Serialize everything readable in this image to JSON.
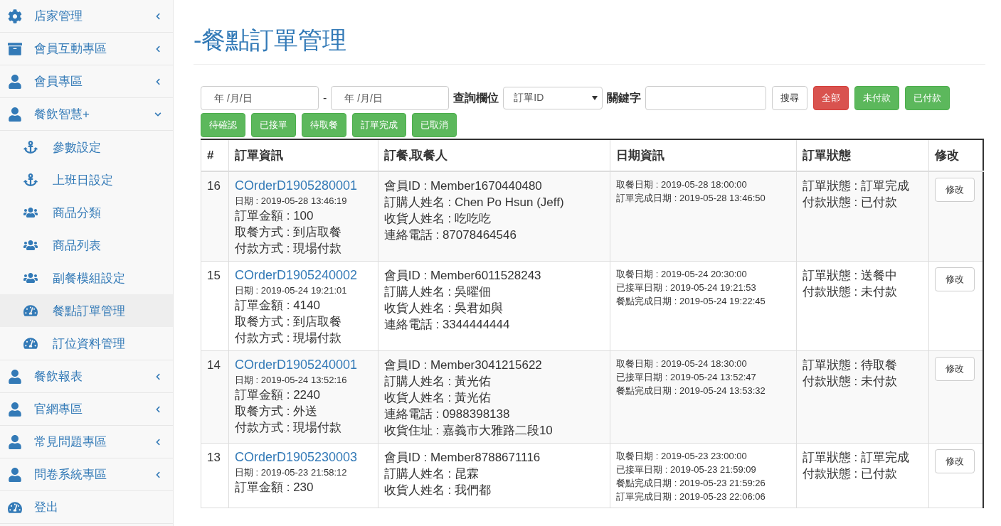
{
  "sidebar": {
    "items": [
      {
        "label": "店家管理",
        "kind": "settings",
        "expanded": false
      },
      {
        "label": "會員互動專區",
        "kind": "archive",
        "expanded": false
      },
      {
        "label": "會員專區",
        "kind": "user",
        "expanded": false
      },
      {
        "label": "餐飲智慧+",
        "kind": "user",
        "expanded": true,
        "children": [
          {
            "label": "參數設定",
            "kind": "anchor",
            "selected": false
          },
          {
            "label": "上班日設定",
            "kind": "anchor",
            "selected": false
          },
          {
            "label": "商品分類",
            "kind": "group",
            "selected": false
          },
          {
            "label": "商品列表",
            "kind": "group",
            "selected": false
          },
          {
            "label": "副餐模組設定",
            "kind": "group",
            "selected": false
          },
          {
            "label": "餐點訂單管理",
            "kind": "gauge",
            "selected": true
          },
          {
            "label": "訂位資料管理",
            "kind": "gauge",
            "selected": false
          }
        ]
      },
      {
        "label": "餐飲報表",
        "kind": "user",
        "expanded": false
      },
      {
        "label": "官網專區",
        "kind": "user",
        "expanded": false
      },
      {
        "label": "常見問題專區",
        "kind": "user",
        "expanded": false
      },
      {
        "label": "問卷系統專區",
        "kind": "user",
        "expanded": false
      }
    ],
    "logout": {
      "label": "登出"
    }
  },
  "page_title": "-餐點訂單管理",
  "filters": {
    "date_from": {
      "placeholder": "年 /月/日"
    },
    "separator": "-",
    "date_to": {
      "placeholder": "年 /月/日"
    },
    "field_label": "查詢欄位",
    "field_select": {
      "value": "訂單ID"
    },
    "keyword_label": "關鍵字",
    "search_button": "搜尋",
    "status_buttons": [
      {
        "label": "全部",
        "kind": "danger"
      },
      {
        "label": "未付款",
        "kind": "success"
      },
      {
        "label": "已付款",
        "kind": "success"
      },
      {
        "label": "待確認",
        "kind": "success"
      },
      {
        "label": "已接單",
        "kind": "success"
      },
      {
        "label": "待取餐",
        "kind": "success"
      },
      {
        "label": "訂單完成",
        "kind": "success"
      },
      {
        "label": "已取消",
        "kind": "success"
      }
    ]
  },
  "table": {
    "columns": [
      "#",
      "訂單資訊",
      "訂餐,取餐人",
      "日期資訊",
      "訂單狀態",
      "修改"
    ],
    "rows": [
      {
        "no": "16",
        "order_id": "COrderD1905280001",
        "date": "日期 : 2019-05-28 13:46:19",
        "order_lines": [
          "訂單金額 : 100",
          "取餐方式 : 到店取餐",
          "付款方式 : 現場付款"
        ],
        "customer": [
          "會員ID : Member1670440480",
          "訂購人姓名 : Chen Po Hsun (Jeff)",
          "收貨人姓名 : 吃吃吃",
          "連絡電話 : 87078464546"
        ],
        "dates": [
          "取餐日期 : 2019-05-28 18:00:00",
          "訂單完成日期 : 2019-05-28 13:46:50"
        ],
        "status": [
          "訂單狀態 : 訂單完成",
          "付款狀態 : 已付款"
        ],
        "action": "修改"
      },
      {
        "no": "15",
        "order_id": "COrderD1905240002",
        "date": "日期 : 2019-05-24 19:21:01",
        "order_lines": [
          "訂單金額 : 4140",
          "取餐方式 : 到店取餐",
          "付款方式 : 現場付款"
        ],
        "customer": [
          "會員ID : Member6011528243",
          "訂購人姓名 : 吳曜佃",
          "收貨人姓名 : 吳君如與",
          "連絡電話 : 3344444444"
        ],
        "dates": [
          "取餐日期 : 2019-05-24 20:30:00",
          "已接單日期 : 2019-05-24 19:21:53",
          "餐點完成日期 : 2019-05-24 19:22:45"
        ],
        "status": [
          "訂單狀態 : 送餐中",
          "付款狀態 : 未付款"
        ],
        "action": "修改"
      },
      {
        "no": "14",
        "order_id": "COrderD1905240001",
        "date": "日期 : 2019-05-24 13:52:16",
        "order_lines": [
          "訂單金額 : 2240",
          "取餐方式 : 外送",
          "付款方式 : 現場付款"
        ],
        "customer": [
          "會員ID : Member3041215622",
          "訂購人姓名 : 黃光佑",
          "收貨人姓名 : 黃光佑",
          "連絡電話 : 0988398138",
          "收貨住址 : 嘉義市大雅路二段10"
        ],
        "dates": [
          "取餐日期 : 2019-05-24 18:30:00",
          "已接單日期 : 2019-05-24 13:52:47",
          "餐點完成日期 : 2019-05-24 13:53:32"
        ],
        "status": [
          "訂單狀態 : 待取餐",
          "付款狀態 : 未付款"
        ],
        "action": "修改"
      },
      {
        "no": "13",
        "order_id": "COrderD1905230003",
        "date": "日期 : 2019-05-23 21:58:12",
        "order_lines": [
          "訂單金額 : 230"
        ],
        "customer": [
          "會員ID : Member8788671116",
          "訂購人姓名 : 昆霖",
          "收貨人姓名 : 我們都"
        ],
        "dates": [
          "取餐日期 : 2019-05-23 23:00:00",
          "已接單日期 : 2019-05-23 21:59:09",
          "餐點完成日期 : 2019-05-23 21:59:26",
          "訂單完成日期 : 2019-05-23 22:06:06"
        ],
        "status": [
          "訂單狀態 : 訂單完成",
          "付款狀態 : 已付款"
        ],
        "action": "修改"
      }
    ]
  }
}
